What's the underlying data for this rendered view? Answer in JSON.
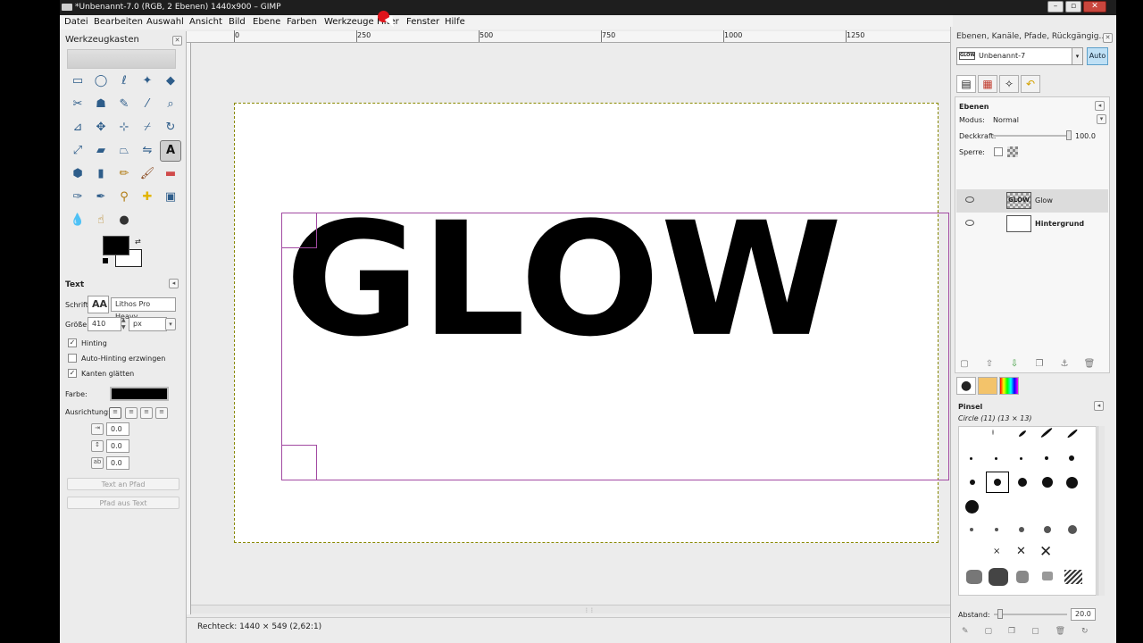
{
  "window": {
    "title": "*Unbenannt-7.0 (RGB, 2 Ebenen) 1440x900 – GIMP"
  },
  "menu": [
    "Datei",
    "Bearbeiten",
    "Auswahl",
    "Ansicht",
    "Bild",
    "Ebene",
    "Farben",
    "Werkzeuge",
    "Filter",
    "Fenster",
    "Hilfe"
  ],
  "toolbox": {
    "title": "Werkzeugkasten",
    "options_title": "Text",
    "font_label": "Schrift:",
    "font_value": "Lithos Pro Heavy",
    "size_label": "Größe:",
    "size_value": "410",
    "size_unit": "px",
    "hinting_label": "Hinting",
    "autohint_label": "Auto-Hinting erzwingen",
    "antialias_label": "Kanten glätten",
    "color_label": "Farbe:",
    "justify_label": "Ausrichtung:",
    "indent_value": "0.0",
    "linespacing_value": "0.0",
    "letterspacing_value": "0.0",
    "text_along_path": "Text an Pfad",
    "path_from_text": "Pfad aus Text"
  },
  "ruler": {
    "labels": [
      "0",
      "250",
      "500",
      "750",
      "1000",
      "1250"
    ]
  },
  "canvas": {
    "text": "GLOW"
  },
  "status": {
    "text": "Rechteck: 1440 × 549  (2,62:1)"
  },
  "dock": {
    "title": "Ebenen, Kanäle, Pfade, Rückgängig...",
    "image_name": "Unbenannt-7",
    "image_thumb": "GLOW",
    "auto_label": "Auto",
    "layers_title": "Ebenen",
    "mode_label": "Modus:",
    "mode_value": "Normal",
    "opacity_label": "Deckkraft:",
    "opacity_value": "100.0",
    "lock_label": "Sperre:",
    "layers": [
      {
        "name": "Glow",
        "thumb": "GLOW"
      },
      {
        "name": "Hintergrund",
        "thumb": ""
      }
    ],
    "brushes_title": "Pinsel",
    "brush_name": "Circle (11) (13 × 13)",
    "spacing_label": "Abstand:",
    "spacing_value": "20.0"
  },
  "colors": {
    "accent": "#a24aa2",
    "guide": "#888800",
    "fg": "#000000",
    "bg": "#ffffff"
  }
}
